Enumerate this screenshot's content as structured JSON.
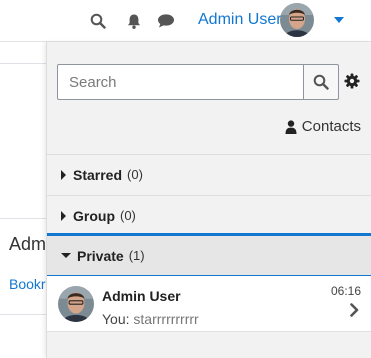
{
  "navbar": {
    "user_name": "Admin User",
    "icons": [
      "search-icon",
      "bell-icon",
      "chat-icon",
      "chevron-down-icon"
    ]
  },
  "background_page": {
    "heading_fragment": "Adm",
    "link_fragment": "Bookr"
  },
  "drawer": {
    "search": {
      "placeholder": "Search",
      "value": ""
    },
    "contacts_label": "Contacts",
    "sections": {
      "starred": {
        "label": "Starred",
        "count": "(0)"
      },
      "group": {
        "label": "Group",
        "count": "(0)"
      },
      "private": {
        "label": "Private",
        "count": "(1)"
      }
    },
    "conversation": {
      "name": "Admin User",
      "preview_prefix": "You:",
      "preview_text": "starrrrrrrrrr",
      "time": "06:16"
    }
  },
  "colors": {
    "accent": "#1177d1",
    "drawer_bg": "#f2f2f2",
    "section_active_bg": "#e6e6e6"
  }
}
